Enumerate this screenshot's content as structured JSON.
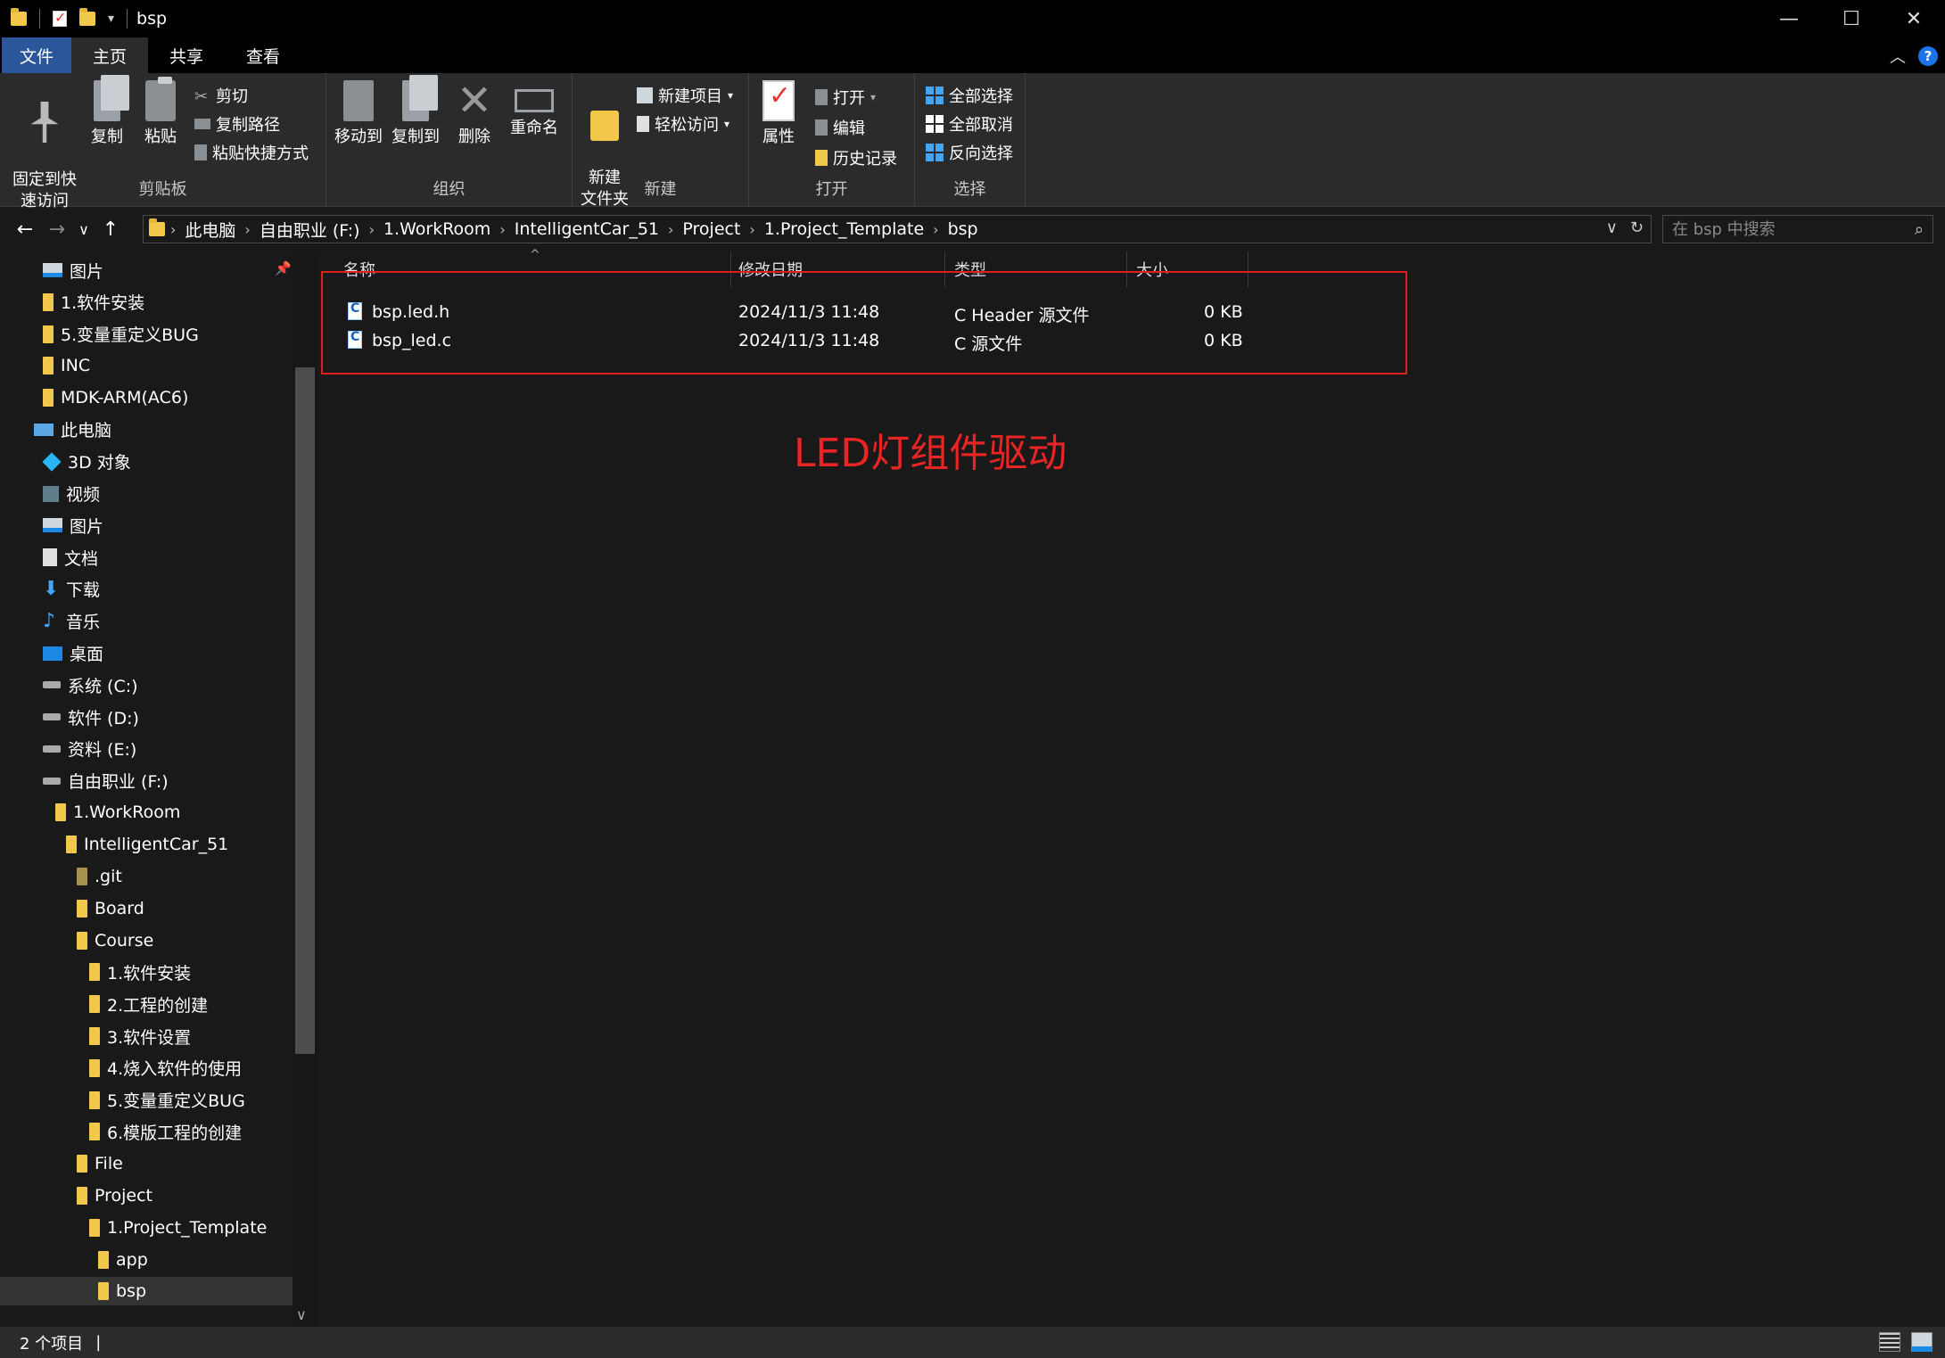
{
  "window": {
    "title": "bsp",
    "minimize": "—",
    "maximize": "☐",
    "close": "✕"
  },
  "ribbon_tabs": [
    "文件",
    "主页",
    "共享",
    "查看"
  ],
  "ribbon": {
    "clipboard": {
      "label": "剪贴板",
      "pin": "固定到快\n速访问",
      "copy": "复制",
      "paste": "粘贴",
      "cut": "剪切",
      "copy_path": "复制路径",
      "paste_shortcut": "粘贴快捷方式"
    },
    "organize": {
      "label": "组织",
      "move_to": "移动到",
      "copy_to": "复制到",
      "delete": "删除",
      "rename": "重命名"
    },
    "new": {
      "label": "新建",
      "new_folder": "新建\n文件夹",
      "new_item": "新建项目",
      "easy_access": "轻松访问"
    },
    "open": {
      "label": "打开",
      "properties": "属性",
      "open": "打开",
      "edit": "编辑",
      "history": "历史记录"
    },
    "select": {
      "label": "选择",
      "select_all": "全部选择",
      "select_none": "全部取消",
      "invert": "反向选择"
    }
  },
  "address": {
    "breadcrumbs": [
      "此电脑",
      "自由职业 (F:)",
      "1.WorkRoom",
      "IntelligentCar_51",
      "Project",
      "1.Project_Template",
      "bsp"
    ],
    "search_placeholder": "在 bsp 中搜索"
  },
  "nav_tree": [
    {
      "label": "图片",
      "icon": "pictures-icon",
      "level": 1
    },
    {
      "label": "1.软件安装",
      "icon": "folder-icon",
      "level": 1
    },
    {
      "label": "5.变量重定义BUG",
      "icon": "folder-icon",
      "level": 1
    },
    {
      "label": "INC",
      "icon": "folder-icon",
      "level": 1
    },
    {
      "label": "MDK-ARM(AC6)",
      "icon": "folder-icon",
      "level": 1
    },
    {
      "label": "此电脑",
      "icon": "pc-icon",
      "level": 0
    },
    {
      "label": "3D 对象",
      "icon": "3d-objects-icon",
      "level": 1
    },
    {
      "label": "视频",
      "icon": "video-icon",
      "level": 1
    },
    {
      "label": "图片",
      "icon": "pictures-icon",
      "level": 1
    },
    {
      "label": "文档",
      "icon": "documents-icon",
      "level": 1
    },
    {
      "label": "下载",
      "icon": "downloads-icon",
      "level": 1
    },
    {
      "label": "音乐",
      "icon": "music-icon",
      "level": 1
    },
    {
      "label": "桌面",
      "icon": "desktop-icon",
      "level": 1
    },
    {
      "label": "系统 (C:)",
      "icon": "drive-icon",
      "level": 1
    },
    {
      "label": "软件 (D:)",
      "icon": "drive-icon",
      "level": 1
    },
    {
      "label": "资料 (E:)",
      "icon": "drive-icon",
      "level": 1
    },
    {
      "label": "自由职业 (F:)",
      "icon": "drive-icon",
      "level": 1
    },
    {
      "label": "1.WorkRoom",
      "icon": "folder-icon",
      "level": 2
    },
    {
      "label": "IntelligentCar_51",
      "icon": "folder-icon",
      "level": 3
    },
    {
      "label": ".git",
      "icon": "folder-icon",
      "level": 4
    },
    {
      "label": "Board",
      "icon": "folder-icon",
      "level": 4
    },
    {
      "label": "Course",
      "icon": "folder-icon",
      "level": 4
    },
    {
      "label": "1.软件安装",
      "icon": "folder-icon",
      "level": 5
    },
    {
      "label": "2.工程的创建",
      "icon": "folder-icon",
      "level": 5
    },
    {
      "label": "3.软件设置",
      "icon": "folder-icon",
      "level": 5
    },
    {
      "label": "4.烧入软件的使用",
      "icon": "folder-icon",
      "level": 5
    },
    {
      "label": "5.变量重定义BUG",
      "icon": "folder-icon",
      "level": 5
    },
    {
      "label": "6.模版工程的创建",
      "icon": "folder-icon",
      "level": 5
    },
    {
      "label": "File",
      "icon": "folder-icon",
      "level": 4
    },
    {
      "label": "Project",
      "icon": "folder-icon",
      "level": 4
    },
    {
      "label": "1.Project_Template",
      "icon": "folder-icon",
      "level": 5
    },
    {
      "label": "app",
      "icon": "folder-icon",
      "level": 6
    },
    {
      "label": "bsp",
      "icon": "folder-icon",
      "level": 6,
      "selected": true
    }
  ],
  "file_list": {
    "columns": [
      "名称",
      "修改日期",
      "类型",
      "大小"
    ],
    "rows": [
      {
        "name": "bsp.led.h",
        "modified": "2024/11/3 11:48",
        "type": "C Header 源文件",
        "size": "0 KB"
      },
      {
        "name": "bsp_led.c",
        "modified": "2024/11/3 11:48",
        "type": "C 源文件",
        "size": "0 KB"
      }
    ]
  },
  "annotation": {
    "text": "LED灯组件驱动",
    "color": "#e82424"
  },
  "status": {
    "item_count": "2 个项目"
  }
}
